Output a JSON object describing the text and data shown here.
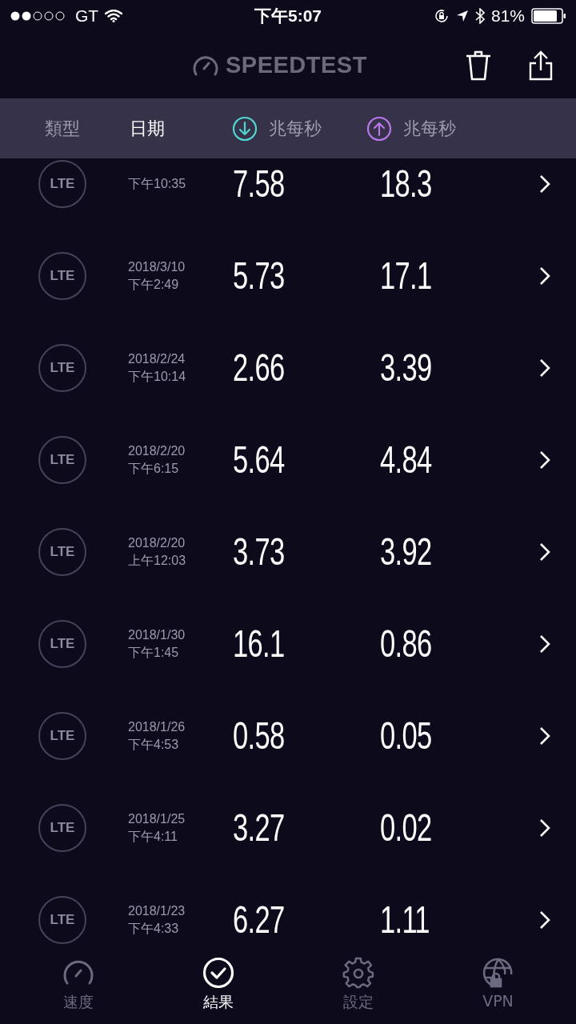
{
  "status_bar": {
    "carrier": "GT",
    "time": "下午5:07",
    "battery": "81%"
  },
  "app_bar": {
    "logo": "SPEEDTEST"
  },
  "columns": [
    {
      "label": "類型",
      "kind": "text",
      "selected": false
    },
    {
      "label": "日期",
      "kind": "text",
      "selected": true
    },
    {
      "label": "兆每秒",
      "kind": "download",
      "selected": false
    },
    {
      "label": "兆每秒",
      "kind": "upload",
      "selected": false
    }
  ],
  "results": [
    {
      "type": "LTE",
      "time": "下午10:35",
      "download": "7.58",
      "upload": "18.3"
    },
    {
      "type": "LTE",
      "date": "2018/3/10",
      "time": "下午2:49",
      "download": "5.73",
      "upload": "17.1"
    },
    {
      "type": "LTE",
      "date": "2018/2/24",
      "time": "下午10:14",
      "download": "2.66",
      "upload": "3.39"
    },
    {
      "type": "LTE",
      "date": "2018/2/20",
      "time": "下午6:15",
      "download": "5.64",
      "upload": "4.84"
    },
    {
      "type": "LTE",
      "date": "2018/2/20",
      "time": "上午12:03",
      "download": "3.73",
      "upload": "3.92"
    },
    {
      "type": "LTE",
      "date": "2018/1/30",
      "time": "下午1:45",
      "download": "16.1",
      "upload": "0.86"
    },
    {
      "type": "LTE",
      "date": "2018/1/26",
      "time": "下午4:53",
      "download": "0.58",
      "upload": "0.05"
    },
    {
      "type": "LTE",
      "date": "2018/1/25",
      "time": "下午4:11",
      "download": "3.27",
      "upload": "0.02"
    },
    {
      "type": "LTE",
      "date": "2018/1/23",
      "time": "下午4:33",
      "download": "6.27",
      "upload": "1.11"
    }
  ],
  "tabs": [
    {
      "label": "速度",
      "kind": "speed",
      "selected": false
    },
    {
      "label": "結果",
      "kind": "results",
      "selected": true
    },
    {
      "label": "設定",
      "kind": "settings",
      "selected": false
    },
    {
      "label": "VPN",
      "kind": "vpn",
      "selected": false
    }
  ]
}
